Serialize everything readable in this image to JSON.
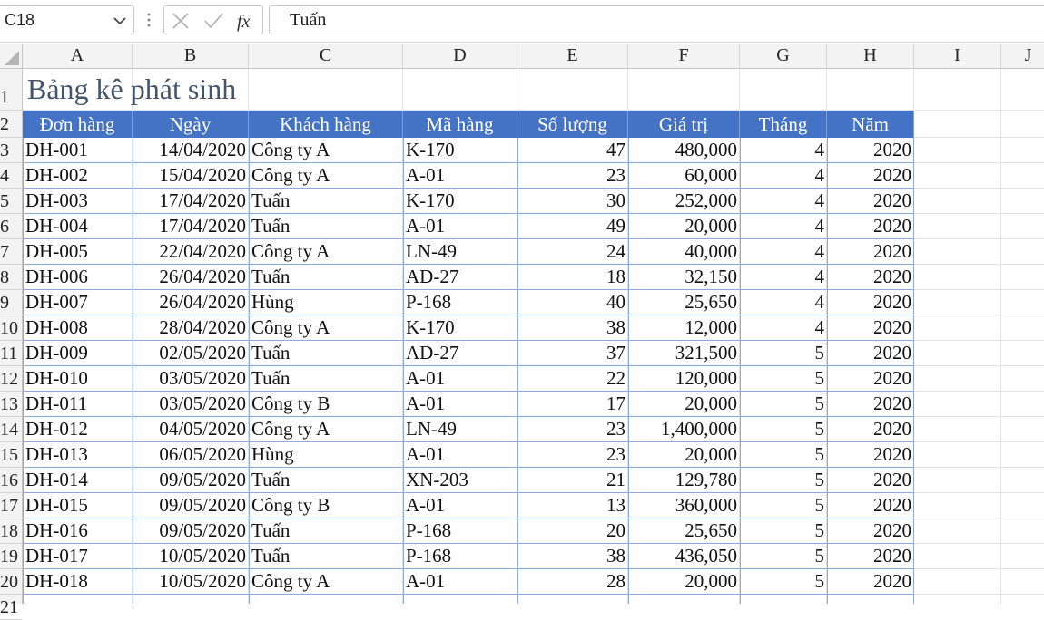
{
  "formula_bar": {
    "name_box": "C18",
    "formula": "Tuấn",
    "icons": [
      "chevron-down-icon",
      "kebab-icon",
      "cancel-icon",
      "check-icon",
      "fx-icon"
    ]
  },
  "columns": [
    "A",
    "B",
    "C",
    "D",
    "E",
    "F",
    "G",
    "H",
    "I",
    "J"
  ],
  "rows": [
    "1",
    "2",
    "3",
    "4",
    "5",
    "6",
    "7",
    "8",
    "9",
    "10",
    "11",
    "12",
    "13",
    "14",
    "15",
    "16",
    "17",
    "18",
    "19",
    "20",
    "21"
  ],
  "sheet": {
    "title": "Bảng kê phát sinh",
    "header": [
      "Đơn hàng",
      "Ngày",
      "Khách hàng",
      "Mã hàng",
      "Số lượng",
      "Giá trị",
      "Tháng",
      "Năm"
    ],
    "data": [
      [
        "DH-001",
        "14/04/2020",
        "Công ty A",
        "K-170",
        "47",
        "480,000",
        "4",
        "2020"
      ],
      [
        "DH-002",
        "15/04/2020",
        "Công ty A",
        "A-01",
        "23",
        "60,000",
        "4",
        "2020"
      ],
      [
        "DH-003",
        "17/04/2020",
        "Tuấn",
        "K-170",
        "30",
        "252,000",
        "4",
        "2020"
      ],
      [
        "DH-004",
        "17/04/2020",
        "Tuấn",
        "A-01",
        "49",
        "20,000",
        "4",
        "2020"
      ],
      [
        "DH-005",
        "22/04/2020",
        "Công ty A",
        "LN-49",
        "24",
        "40,000",
        "4",
        "2020"
      ],
      [
        "DH-006",
        "26/04/2020",
        "Tuấn",
        "AD-27",
        "18",
        "32,150",
        "4",
        "2020"
      ],
      [
        "DH-007",
        "26/04/2020",
        "Hùng",
        "P-168",
        "40",
        "25,650",
        "4",
        "2020"
      ],
      [
        "DH-008",
        "28/04/2020",
        "Công ty A",
        "K-170",
        "38",
        "12,000",
        "4",
        "2020"
      ],
      [
        "DH-009",
        "02/05/2020",
        "Tuấn",
        "AD-27",
        "37",
        "321,500",
        "5",
        "2020"
      ],
      [
        "DH-010",
        "03/05/2020",
        "Tuấn",
        "A-01",
        "22",
        "120,000",
        "5",
        "2020"
      ],
      [
        "DH-011",
        "03/05/2020",
        "Công ty B",
        "A-01",
        "17",
        "20,000",
        "5",
        "2020"
      ],
      [
        "DH-012",
        "04/05/2020",
        "Công ty A",
        "LN-49",
        "23",
        "1,400,000",
        "5",
        "2020"
      ],
      [
        "DH-013",
        "06/05/2020",
        "Hùng",
        "A-01",
        "23",
        "20,000",
        "5",
        "2020"
      ],
      [
        "DH-014",
        "09/05/2020",
        "Tuấn",
        "XN-203",
        "21",
        "129,780",
        "5",
        "2020"
      ],
      [
        "DH-015",
        "09/05/2020",
        "Công ty B",
        "A-01",
        "13",
        "360,000",
        "5",
        "2020"
      ],
      [
        "DH-016",
        "09/05/2020",
        "Tuấn",
        "P-168",
        "20",
        "25,650",
        "5",
        "2020"
      ],
      [
        "DH-017",
        "10/05/2020",
        "Tuấn",
        "P-168",
        "38",
        "436,050",
        "5",
        "2020"
      ],
      [
        "DH-018",
        "10/05/2020",
        "Công ty A",
        "A-01",
        "28",
        "20,000",
        "5",
        "2020"
      ]
    ]
  },
  "colors": {
    "table_header_bg": "#4472c4",
    "table_border": "#8ea9db",
    "title": "#44546a"
  }
}
